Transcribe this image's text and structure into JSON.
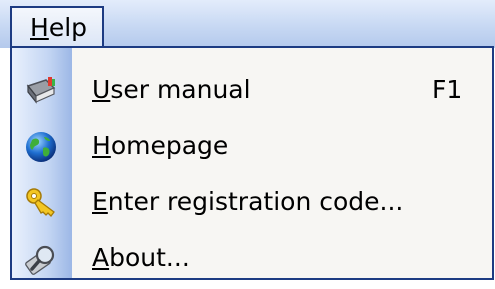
{
  "menu": {
    "title_mnemonic": "H",
    "title_rest": "elp",
    "items": [
      {
        "mnemonic": "U",
        "rest": "ser manual",
        "shortcut": "F1",
        "icon": "book-icon"
      },
      {
        "mnemonic": "H",
        "rest": "omepage",
        "shortcut": "",
        "icon": "globe-icon"
      },
      {
        "mnemonic": "E",
        "rest": "nter registration code...",
        "shortcut": "",
        "icon": "key-icon"
      },
      {
        "mnemonic": "A",
        "rest": "bout...",
        "shortcut": "",
        "icon": "magnifier-icon"
      }
    ]
  },
  "colors": {
    "border": "#1d3b82",
    "menu_bg": "#f7f6f3",
    "gutter": "#c4d6f3"
  }
}
